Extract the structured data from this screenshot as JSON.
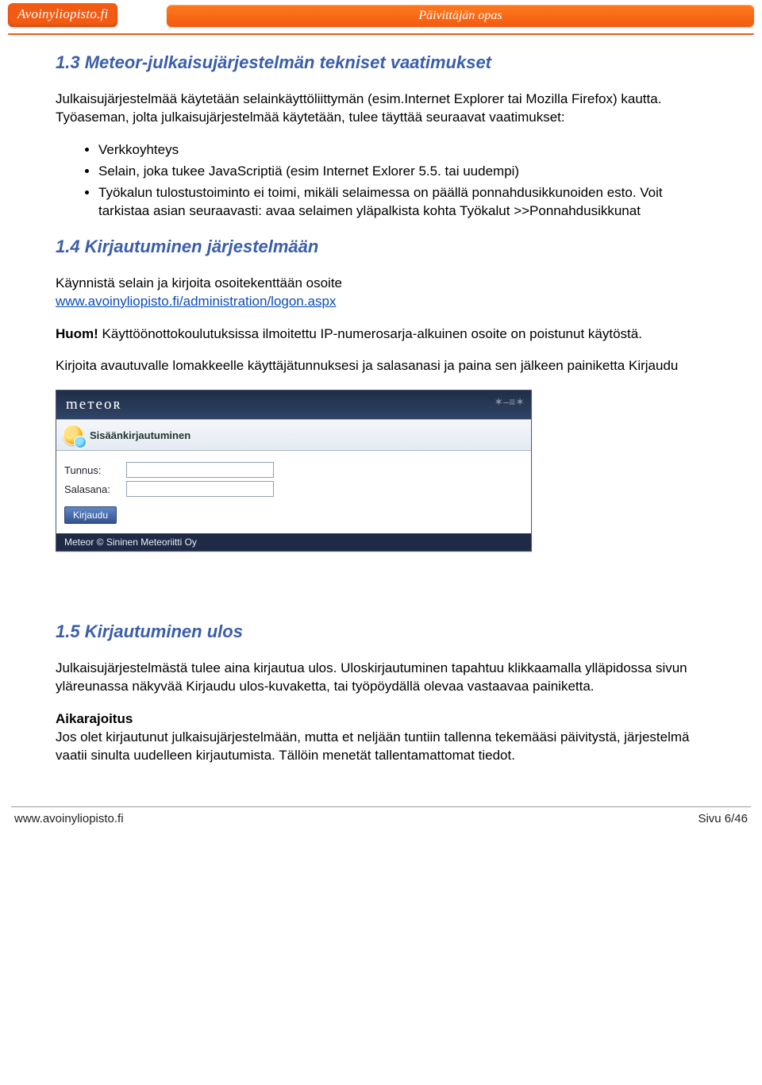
{
  "header": {
    "logo_text": "Avoinyliopisto.fi",
    "title": "Päivittäjän opas"
  },
  "sections": {
    "s13_title": "1.3 Meteor-julkaisujärjestelmän tekniset vaatimukset",
    "s13_p1": "Julkaisujärjestelmää käytetään selainkäyttöliittymän (esim.Internet Explorer tai Mozilla Firefox) kautta. Työaseman, jolta julkaisujärjestelmää käytetään, tulee täyttää seuraavat vaatimukset:",
    "s13_bullets": [
      "Verkkoyhteys",
      "Selain, joka tukee JavaScriptiä (esim Internet Exlorer 5.5. tai uudempi)",
      "Työkalun tulostustoiminto ei toimi, mikäli selaimessa on päällä ponnahdusikkunoiden esto. Voit tarkistaa asian seuraavasti: avaa selaimen yläpalkista kohta Työkalut >>Ponnahdusikkunat"
    ],
    "s14_title": "1.4 Kirjautuminen järjestelmään",
    "s14_p1": "Käynnistä selain ja kirjoita osoitekenttään osoite",
    "s14_link": "www.avoinyliopisto.fi/administration/logon.aspx",
    "s14_huom_label": "Huom!",
    "s14_huom_text": " Käyttöönottokoulutuksissa ilmoitettu IP-numerosarja-alkuinen osoite on poistunut käytöstä.",
    "s14_p2": "Kirjoita avautuvalle lomakkeelle käyttäjätunnuksesi ja salasanasi ja paina sen jälkeen painiketta Kirjaudu",
    "s15_title": "1.5 Kirjautuminen ulos",
    "s15_p1": "Julkaisujärjestelmästä tulee aina kirjautua ulos. Uloskirjautuminen tapahtuu klikkaamalla ylläpidossa sivun yläreunassa näkyvää Kirjaudu ulos-kuvaketta, tai työpöydällä olevaa vastaavaa painiketta.",
    "s15_sub_label": "Aikarajoitus",
    "s15_p2": "Jos olet kirjautunut julkaisujärjestelmään, mutta et neljään tuntiin tallenna tekemääsi päivitystä, järjestelmä vaatii sinulta uudelleen kirjautumista. Tällöin menetät tallentamattomat tiedot."
  },
  "login_app": {
    "brand": "meтeoʀ",
    "panel_title": "Sisäänkirjautuminen",
    "field_user": "Tunnus:",
    "field_pass": "Salasana:",
    "btn_label": "Kirjaudu",
    "footer_text": "Meteor © Sininen Meteoriitti Oy"
  },
  "footer": {
    "left": "www.avoinyliopisto.fi",
    "right": "Sivu 6/46"
  }
}
